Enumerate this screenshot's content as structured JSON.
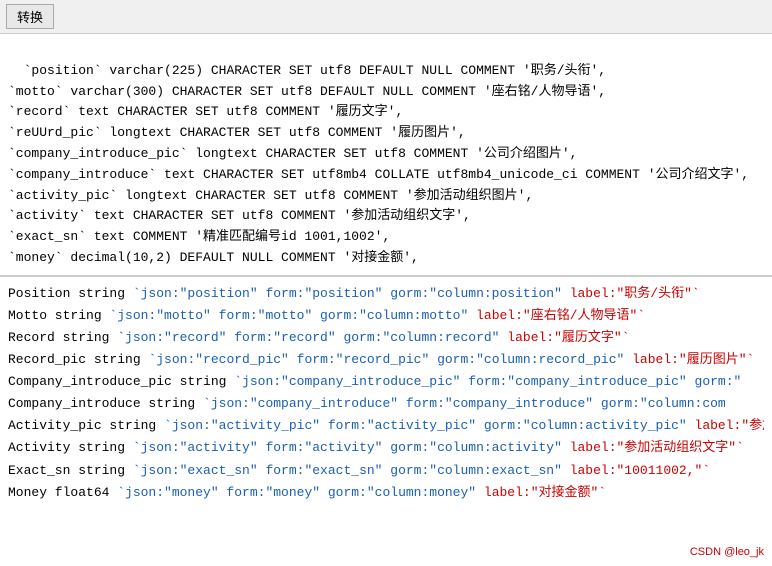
{
  "toolbar": {
    "convert_label": "转换"
  },
  "sql_content": "`position` varchar(225) CHARACTER SET utf8 DEFAULT NULL COMMENT '职务/头衔',\n`motto` varchar(300) CHARACTER SET utf8 DEFAULT NULL COMMENT '座右铭/人物导语',\n`record` text CHARACTER SET utf8 COMMENT '履历文字',\n`reUUrd_pic` longtext CHARACTER SET utf8 COMMENT '履历图片',\n`company_introduce_pic` longtext CHARACTER SET utf8 COMMENT '公司介绍图片',\n`company_introduce` text CHARACTER SET utf8mb4 COLLATE utf8mb4_unicode_ci COMMENT '公司介绍文字',\n`activity_pic` longtext CHARACTER SET utf8 COMMENT '参加活动组织图片',\n`activity` text CHARACTER SET utf8 COMMENT '参加活动组织文字',\n`exact_sn` text COMMENT '精准匹配编号id 1001,1002',\n`money` decimal(10,2) DEFAULT NULL COMMENT '对接金额',",
  "results": [
    {
      "field": "Position",
      "type": "string",
      "tags": "`json:\"position\" form:\"position\" gorm:\"column:position\"",
      "label": "label:\"职务/头衔`\""
    },
    {
      "field": "Motto",
      "type": "string",
      "tags": "`json:\"motto\" form:\"motto\" gorm:\"column:motto\"",
      "label": "label:\"座右铭/人物导语`\""
    },
    {
      "field": "Record",
      "type": "string",
      "tags": "`json:\"record\" form:\"record\" gorm:\"column:record\"",
      "label": "label:\"履历文字`\""
    },
    {
      "field": "Record_pic",
      "type": "string",
      "tags": "`json:\"record_pic\" form:\"record_pic\" gorm:\"column:record_pic\"",
      "label": "label:\"履历图片`\""
    },
    {
      "field": "Company_introduce_pic",
      "type": "string",
      "tags": "`json:\"company_introduce_pic\" form:\"company_introduce_pic\" gorm:\"",
      "label": ""
    },
    {
      "field": "Company_introduce",
      "type": "string",
      "tags": "`json:\"company_introduce\" form:\"company_introduce\" gorm:\"column:com",
      "label": ""
    },
    {
      "field": "Activity_pic",
      "type": "string",
      "tags": "`json:\"activity_pic\" form:\"activity_pic\" gorm:\"column:activity_pic\"",
      "label": "label:\"参加活动组织"
    },
    {
      "field": "Activity",
      "type": "string",
      "tags": "`json:\"activity\" form:\"activity\" gorm:\"column:activity\"",
      "label": "label:\"参加活动组织文字`\""
    },
    {
      "field": "Exact_sn",
      "type": "string",
      "tags": "`json:\"exact_sn\" form:\"exact_sn\" gorm:\"column:exact_sn\"",
      "label": "label:\"10011002,`\""
    },
    {
      "field": "Money",
      "type": "float64",
      "tags": "`json:\"money\" form:\"money\" gorm:\"column:money\"",
      "label": "label:\"对接金额`\""
    }
  ],
  "watermark": "CSDN @leo_jk"
}
